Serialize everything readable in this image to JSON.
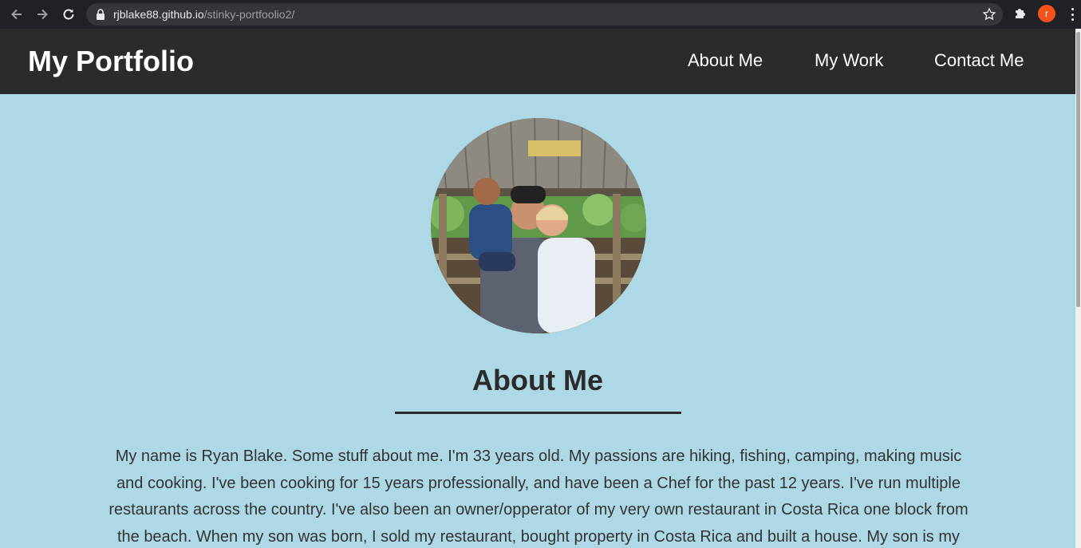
{
  "browser": {
    "url_host": "rjblake88.github.io",
    "url_path": "/stinky-portfoolio2/",
    "profile_initial": "r",
    "icons": [
      "back-arrow-icon",
      "forward-arrow-icon",
      "reload-icon",
      "lock-icon",
      "star-icon",
      "extensions-puzzle-icon",
      "more-menu-icon"
    ]
  },
  "header": {
    "title": "My Portfolio",
    "nav": [
      {
        "label": "About Me"
      },
      {
        "label": "My Work"
      },
      {
        "label": "Contact Me"
      }
    ]
  },
  "about": {
    "heading": "About Me",
    "bio": "My name is Ryan Blake. Some stuff about me. I'm 33 years old. My passions are hiking, fishing, camping, making music and cooking. I've been cooking for 15 years professionally, and have been a Chef for the past 12 years. I've run multiple restaurants across the country. I've also been an owner/opperator of my very own restaurant in Costa Rica one block from the beach. When my son was born, I sold my restaurant, bought property in Costa Rica and built a house. My son is my"
  },
  "colors": {
    "page_bg": "#add8e6",
    "header_bg": "#2b2b2b",
    "profile_badge": "#f4511e"
  }
}
